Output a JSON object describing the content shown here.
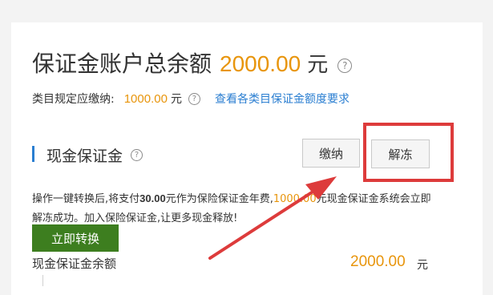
{
  "header": {
    "title": "保证金账户总余额",
    "amount": "2000.00",
    "unit": "元"
  },
  "required": {
    "label": "类目规定应缴纳:",
    "amount": "1000.00",
    "unit": "元",
    "link": "查看各类目保证金额度要求"
  },
  "cash_section": {
    "title": "现金保证金",
    "pay_button": "缴纳",
    "unfreeze_button": "解冻"
  },
  "notice": {
    "part1": "操作一键转换后,将支付",
    "fee": "30.00",
    "part2": "元作为保险保证金年费,",
    "amount": "1000.00",
    "part3": "元现金保证金系统会立即解冻成功。加入保险保证金,让更多现金释放!"
  },
  "convert_button": "立即转换",
  "balance": {
    "label": "现金保证金余额",
    "amount": "2000.00",
    "unit": "元"
  },
  "icons": {
    "help": "help-circle-icon",
    "annotation_arrow": "red-arrow-icon"
  },
  "colors": {
    "accent_orange": "#e8950c",
    "link_blue": "#2a7ed1",
    "convert_green": "#3d7e1f",
    "annotation_red": "#dd3b3b"
  }
}
